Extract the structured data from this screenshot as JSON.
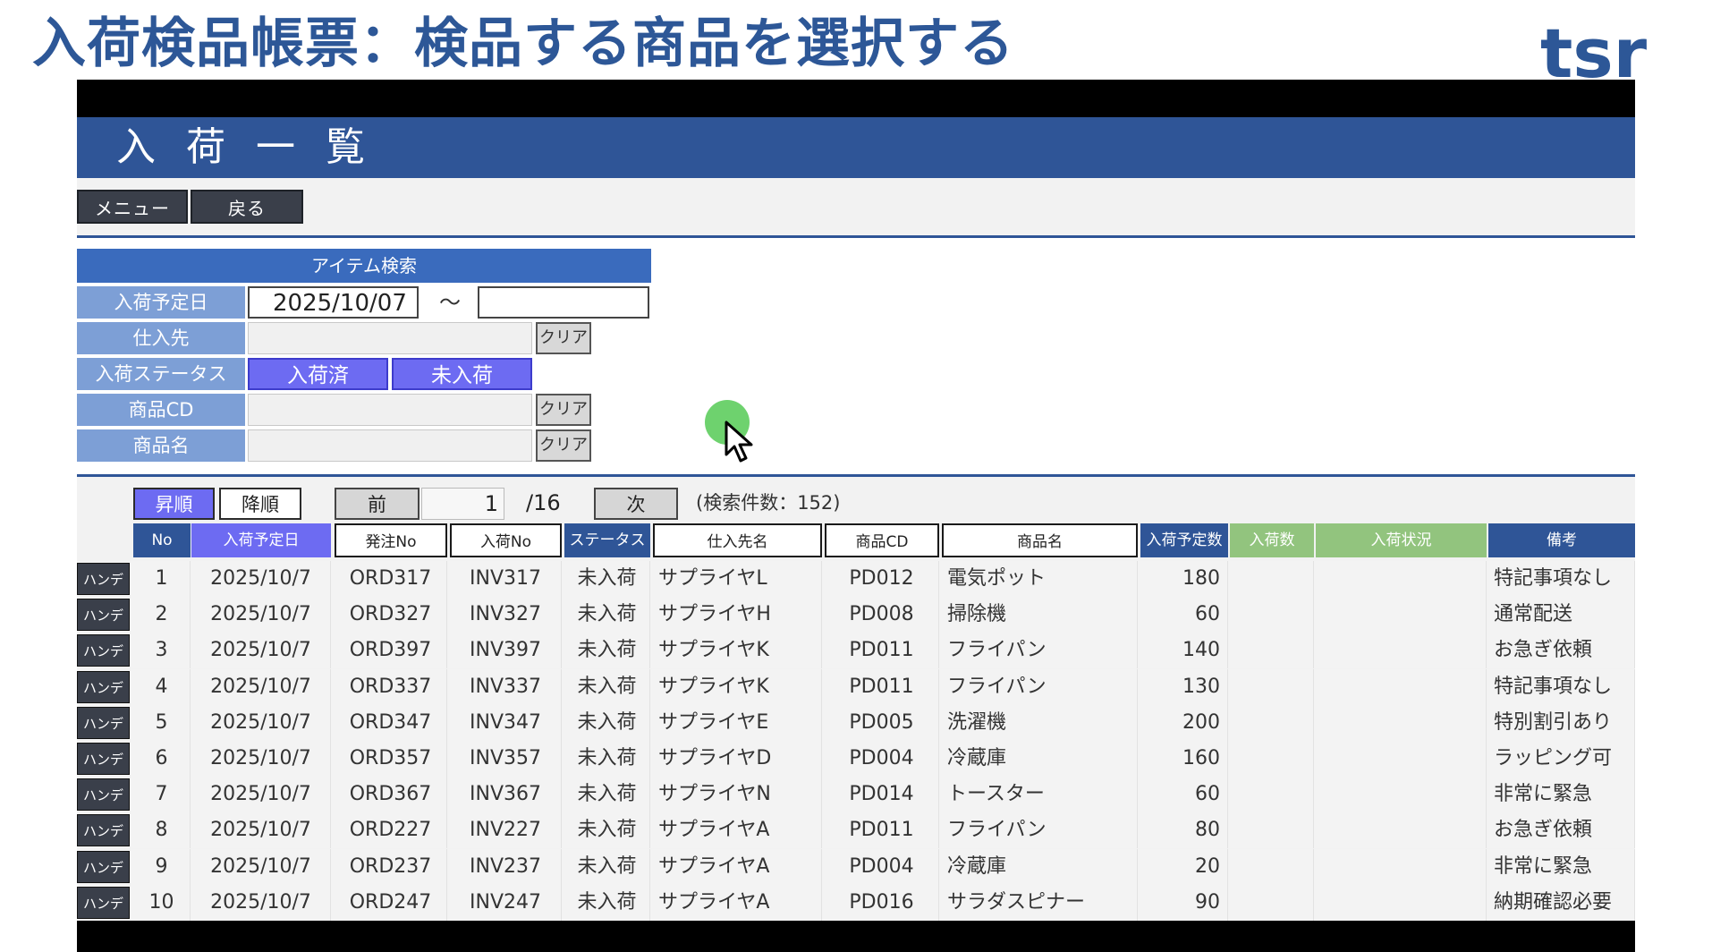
{
  "slide": {
    "title": "入荷検品帳票：検品する商品を選択する",
    "logo_text": "tsr",
    "title_color": "#2d5797"
  },
  "app": {
    "title": "入荷一覧",
    "title_bar_color": "#2f5597",
    "toolbar": {
      "menu_label": "メニュー",
      "back_label": "戻る"
    }
  },
  "search": {
    "header": "アイテム検索",
    "date_label": "入荷予定日",
    "date_from": "2025/10/07",
    "date_sep": "～",
    "date_to": "",
    "supplier_label": "仕入先",
    "supplier_value": "",
    "status_label": "入荷ステータス",
    "status_received": "入荷済",
    "status_not_received": "未入荷",
    "product_cd_label": "商品CD",
    "product_cd_value": "",
    "product_name_label": "商品名",
    "product_name_value": "",
    "clear_label": "クリア"
  },
  "pager": {
    "asc_label": "昇順",
    "desc_label": "降順",
    "prev_label": "前",
    "page": "1",
    "total_pages": "/16",
    "next_label": "次",
    "count_text": "(検索件数：152)"
  },
  "table": {
    "headers": {
      "no": "No",
      "date": "入荷予定日",
      "order_no": "発注No",
      "invoice_no": "入荷No",
      "status": "ステータス",
      "supplier": "仕入先名",
      "product_cd": "商品CD",
      "product_name": "商品名",
      "planned_qty": "入荷予定数",
      "received_qty": "入荷数",
      "received_status": "入荷状況",
      "remarks": "備考"
    },
    "handy_label": "ハンディ",
    "rows": [
      {
        "no": "1",
        "date": "2025/10/7",
        "order_no": "ORD317",
        "invoice_no": "INV317",
        "status": "未入荷",
        "supplier": "サプライヤL",
        "product_cd": "PD012",
        "product_name": "電気ポット",
        "planned_qty": "180",
        "received_qty": "",
        "received_status": "",
        "remarks": "特記事項なし"
      },
      {
        "no": "2",
        "date": "2025/10/7",
        "order_no": "ORD327",
        "invoice_no": "INV327",
        "status": "未入荷",
        "supplier": "サプライヤH",
        "product_cd": "PD008",
        "product_name": "掃除機",
        "planned_qty": "60",
        "received_qty": "",
        "received_status": "",
        "remarks": "通常配送"
      },
      {
        "no": "3",
        "date": "2025/10/7",
        "order_no": "ORD397",
        "invoice_no": "INV397",
        "status": "未入荷",
        "supplier": "サプライヤK",
        "product_cd": "PD011",
        "product_name": "フライパン",
        "planned_qty": "140",
        "received_qty": "",
        "received_status": "",
        "remarks": "お急ぎ依頼"
      },
      {
        "no": "4",
        "date": "2025/10/7",
        "order_no": "ORD337",
        "invoice_no": "INV337",
        "status": "未入荷",
        "supplier": "サプライヤK",
        "product_cd": "PD011",
        "product_name": "フライパン",
        "planned_qty": "130",
        "received_qty": "",
        "received_status": "",
        "remarks": "特記事項なし"
      },
      {
        "no": "5",
        "date": "2025/10/7",
        "order_no": "ORD347",
        "invoice_no": "INV347",
        "status": "未入荷",
        "supplier": "サプライヤE",
        "product_cd": "PD005",
        "product_name": "洗濯機",
        "planned_qty": "200",
        "received_qty": "",
        "received_status": "",
        "remarks": "特別割引あり"
      },
      {
        "no": "6",
        "date": "2025/10/7",
        "order_no": "ORD357",
        "invoice_no": "INV357",
        "status": "未入荷",
        "supplier": "サプライヤD",
        "product_cd": "PD004",
        "product_name": "冷蔵庫",
        "planned_qty": "160",
        "received_qty": "",
        "received_status": "",
        "remarks": "ラッピング可"
      },
      {
        "no": "7",
        "date": "2025/10/7",
        "order_no": "ORD367",
        "invoice_no": "INV367",
        "status": "未入荷",
        "supplier": "サプライヤN",
        "product_cd": "PD014",
        "product_name": "トースター",
        "planned_qty": "60",
        "received_qty": "",
        "received_status": "",
        "remarks": "非常に緊急"
      },
      {
        "no": "8",
        "date": "2025/10/7",
        "order_no": "ORD227",
        "invoice_no": "INV227",
        "status": "未入荷",
        "supplier": "サプライヤA",
        "product_cd": "PD011",
        "product_name": "フライパン",
        "planned_qty": "80",
        "received_qty": "",
        "received_status": "",
        "remarks": "お急ぎ依頼"
      },
      {
        "no": "9",
        "date": "2025/10/7",
        "order_no": "ORD237",
        "invoice_no": "INV237",
        "status": "未入荷",
        "supplier": "サプライヤA",
        "product_cd": "PD004",
        "product_name": "冷蔵庫",
        "planned_qty": "20",
        "received_qty": "",
        "received_status": "",
        "remarks": "非常に緊急"
      },
      {
        "no": "10",
        "date": "2025/10/7",
        "order_no": "ORD247",
        "invoice_no": "INV247",
        "status": "未入荷",
        "supplier": "サプライヤA",
        "product_cd": "PD016",
        "product_name": "サラダスピナー",
        "planned_qty": "90",
        "received_qty": "",
        "received_status": "",
        "remarks": "納期確認必要"
      }
    ]
  },
  "colors": {
    "accent_blue": "#2f5597",
    "label_blue": "#7d9fd6",
    "status_violet": "#6d6bf2",
    "header_green": "#92c47e",
    "cursor_highlight": "#66d066"
  },
  "icons": {
    "cursor": "mouse-pointer-icon",
    "logo": "tsr-logo"
  }
}
